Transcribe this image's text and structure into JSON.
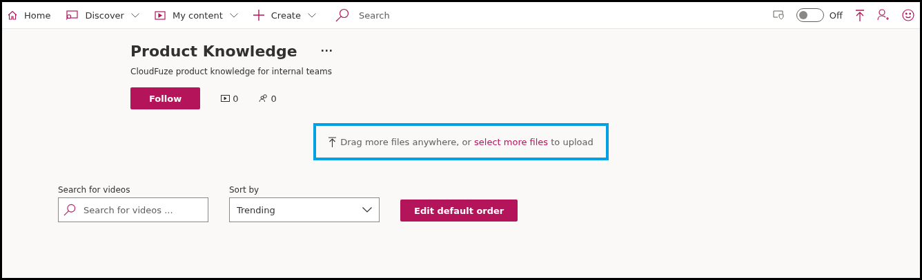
{
  "nav": [
    {
      "kind": "home",
      "label": "Home",
      "dropdown": false
    },
    {
      "kind": "discover",
      "label": "Discover",
      "dropdown": true
    },
    {
      "kind": "content",
      "label": "My content",
      "dropdown": true
    },
    {
      "kind": "create",
      "label": "Create",
      "dropdown": true
    }
  ],
  "search": {
    "placeholder": "Search"
  },
  "toggle": {
    "on": false,
    "label": "Off"
  },
  "channel": {
    "title": "Product Knowledge",
    "menu": "···",
    "description": "CloudFuze product knowledge for internal teams",
    "follow": "Follow",
    "videos": "0",
    "followers": "0"
  },
  "upload": {
    "before": "Drag more files anywhere, or ",
    "link": "select more files",
    "after": " to upload"
  },
  "filters": {
    "search_label": "Search for videos",
    "search_placeholder": "Search for videos ...",
    "sort_label": "Sort by",
    "sort_value": "Trending",
    "edit_button": "Edit default order"
  }
}
